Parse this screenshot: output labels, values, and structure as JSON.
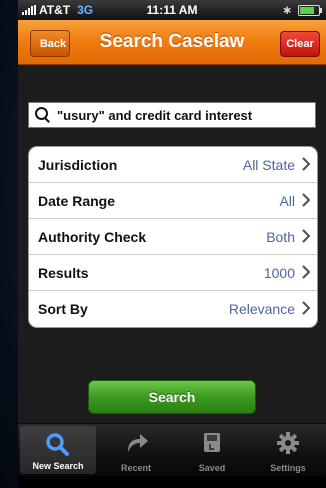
{
  "status_bar": {
    "carrier": "AT&T",
    "network": "3G",
    "time": "11:11 AM"
  },
  "nav": {
    "back_label": "Back",
    "title": "Search Caselaw",
    "clear_label": "Clear"
  },
  "search": {
    "query": "\"usury\" and credit card interest"
  },
  "options": [
    {
      "label": "Jurisdiction",
      "value": "All State"
    },
    {
      "label": "Date Range",
      "value": "All"
    },
    {
      "label": "Authority Check",
      "value": "Both"
    },
    {
      "label": "Results",
      "value": "1000"
    },
    {
      "label": "Sort By",
      "value": "Relevance"
    }
  ],
  "search_button_label": "Search",
  "tabs": [
    {
      "label": "New Search",
      "icon": "search-icon",
      "active": true
    },
    {
      "label": "Recent",
      "icon": "recent-arrow-icon",
      "active": false
    },
    {
      "label": "Saved",
      "icon": "saved-icon",
      "active": false
    },
    {
      "label": "Settings",
      "icon": "gear-icon",
      "active": false
    }
  ],
  "colors": {
    "nav_orange": "#f07b10",
    "clear_red": "#d01e12",
    "search_green": "#3c9a22",
    "value_blue": "#4a66a0"
  }
}
